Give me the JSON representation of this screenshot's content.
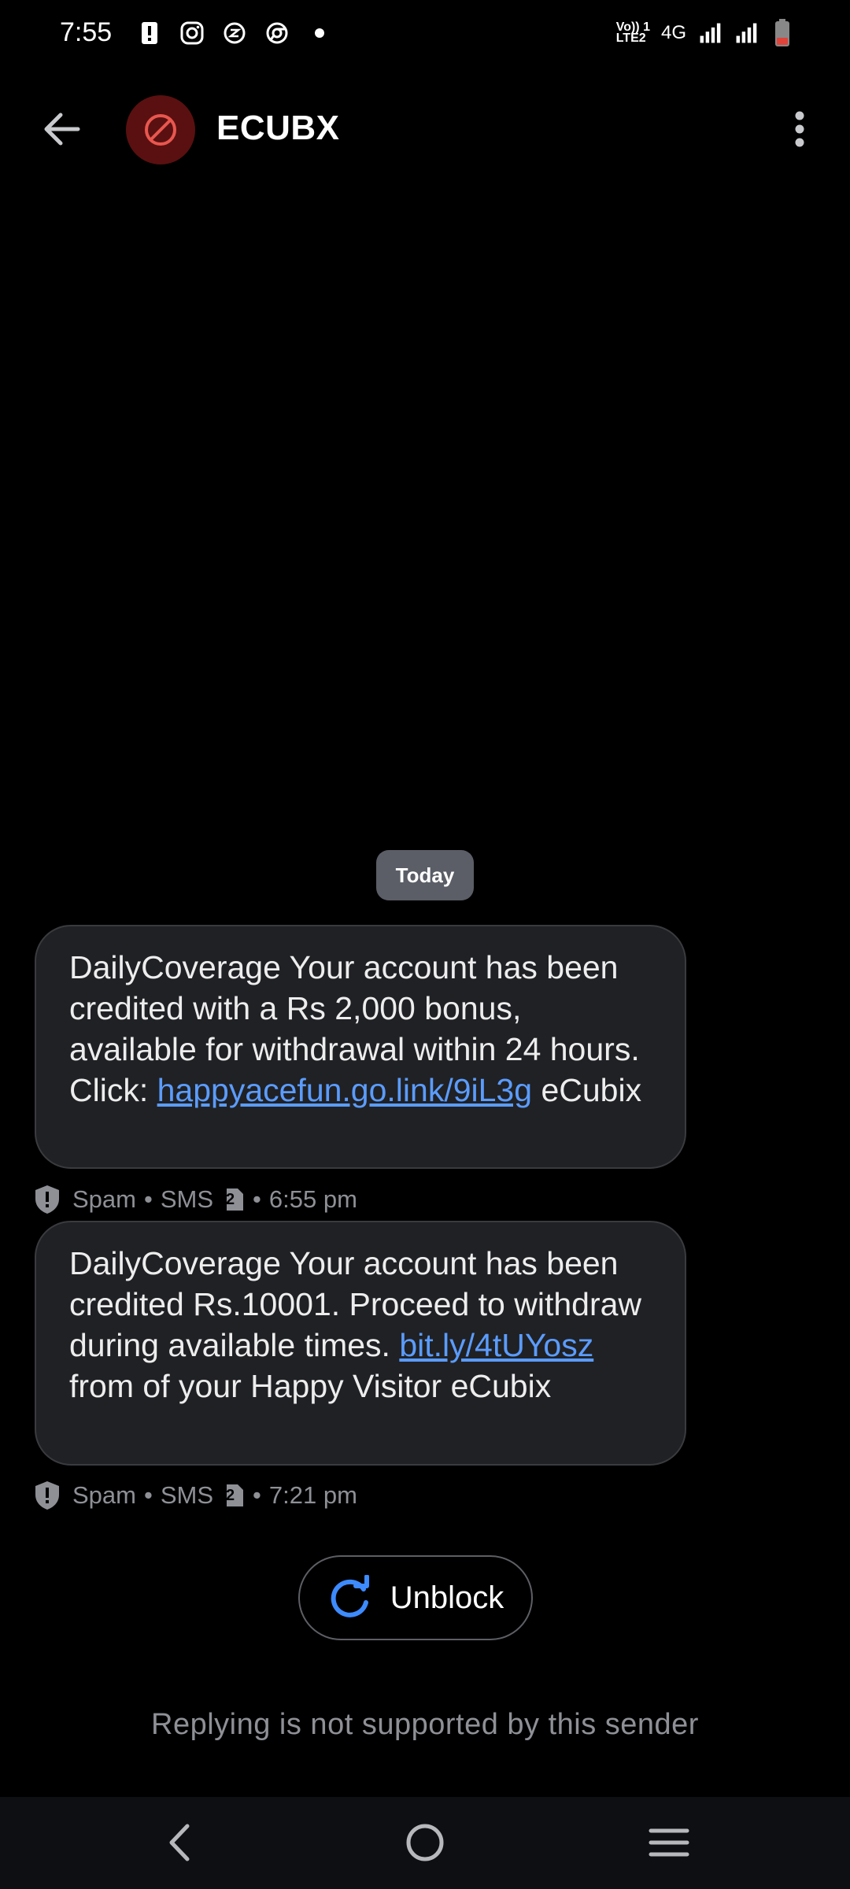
{
  "status_bar": {
    "time": "7:55",
    "left_icons": [
      "alert-icon",
      "instagram-icon",
      "threads-icon",
      "chrome-icon",
      "dot-icon"
    ],
    "network_label_top": "Vo)) 1",
    "network_label_bottom": "LTE2",
    "network_type": "4G",
    "battery_color": "#e0433a"
  },
  "header": {
    "title": "ECUBX",
    "avatar_icon": "block-icon",
    "avatar_color": "#5a1010",
    "accent_color": "#e8574f"
  },
  "conversation": {
    "date_label": "Today",
    "messages": [
      {
        "text_before_link": "DailyCoverage Your account has been credited with a Rs 2,000 bonus, available for withdrawal within 24 hours. Click: ",
        "link": "happyacefun.go.link/9iL3g",
        "text_after_link": " eCubix",
        "label_spam": "Spam",
        "label_sms": "SMS",
        "sim": "2",
        "time": "6:55 pm"
      },
      {
        "text_before_link": "DailyCoverage Your account has been credited Rs.10001. Proceed to withdraw during available times. ",
        "link": "bit.ly/4tUYosz",
        "text_after_link": " from of your Happy Visitor eCubix",
        "label_spam": "Spam",
        "label_sms": "SMS",
        "sim": "2",
        "time": "7:21 pm"
      }
    ],
    "separator": "•"
  },
  "unblock": {
    "label": "Unblock",
    "icon": "refresh-icon",
    "icon_color": "#3d8bff"
  },
  "reply_note": "Replying is not supported by this sender",
  "nav_bar": {
    "buttons": [
      "back-nav-icon",
      "home-nav-icon",
      "recents-nav-icon"
    ]
  }
}
